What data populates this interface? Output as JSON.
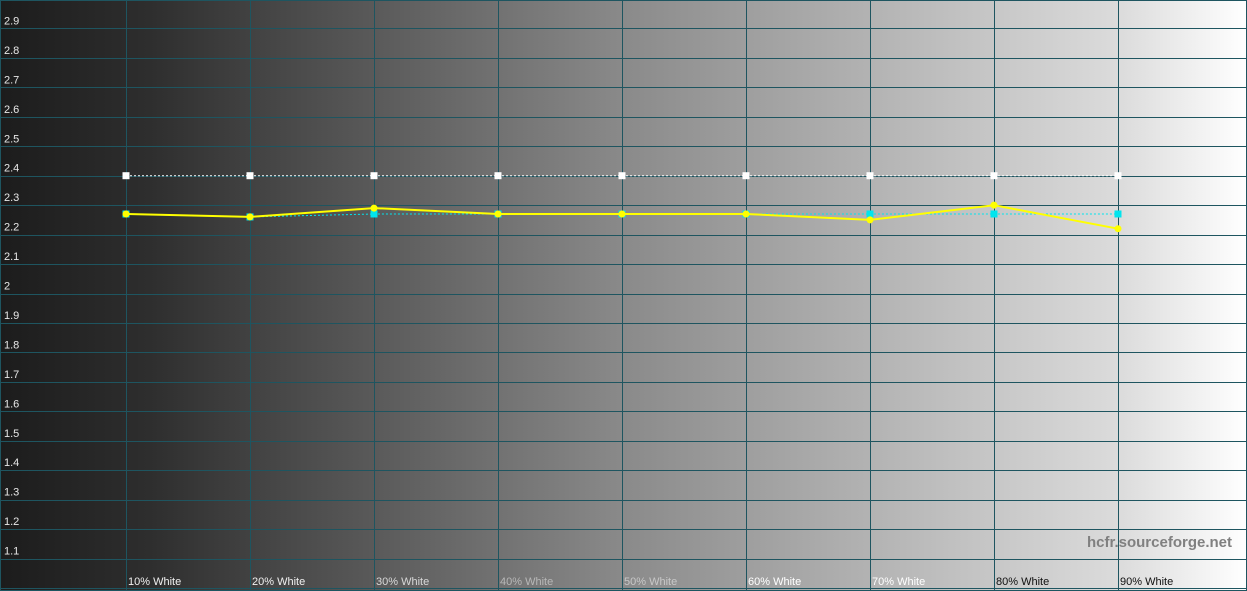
{
  "chart_data": {
    "type": "line",
    "title": "",
    "xlabel": "",
    "ylabel": "",
    "categories": [
      "10% White",
      "20% White",
      "30% White",
      "40% White",
      "50% White",
      "60% White",
      "70% White",
      "80% White",
      "90% White"
    ],
    "ylim": [
      1.0,
      3.0
    ],
    "yticks": [
      1.1,
      1.2,
      1.3,
      1.4,
      1.5,
      1.6,
      1.7,
      1.8,
      1.9,
      2,
      2.1,
      2.2,
      2.3,
      2.4,
      2.5,
      2.6,
      2.7,
      2.8,
      2.9
    ],
    "grid": true,
    "series": [
      {
        "values": [
          2.4,
          2.4,
          2.4,
          2.4,
          2.4,
          2.4,
          2.4,
          2.4,
          2.4
        ],
        "color": "#ffffff",
        "style": "dotted",
        "marker": "square"
      },
      {
        "values": [
          2.27,
          2.26,
          2.27,
          2.27,
          2.27,
          2.27,
          2.27,
          2.27,
          2.27
        ],
        "color": "#00e5ee",
        "style": "dotted",
        "marker": "square"
      },
      {
        "values": [
          2.27,
          2.26,
          2.29,
          2.27,
          2.27,
          2.27,
          2.25,
          2.3,
          2.22
        ],
        "color": "#ffff00",
        "style": "solid",
        "marker": "circle"
      }
    ]
  },
  "watermark": "hcfr.sourceforge.net",
  "colors": {
    "grid": "#1e5560",
    "ytick_text": "#e8e8e8",
    "watermark_text": "#808080"
  }
}
